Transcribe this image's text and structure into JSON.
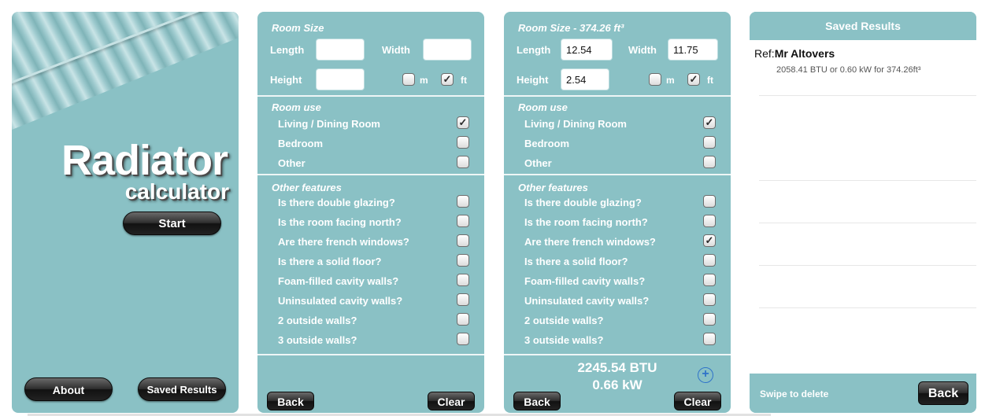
{
  "home": {
    "title": "Radiator",
    "subtitle": "calculator",
    "start_label": "Start",
    "about_label": "About",
    "saved_label": "Saved Results"
  },
  "calc_empty": {
    "room_size_title": "Room Size",
    "length_label": "Length",
    "width_label": "Width",
    "height_label": "Height",
    "length_value": "",
    "width_value": "",
    "height_value": "",
    "unit_m": "m",
    "unit_ft": "ft",
    "m_checked": "",
    "ft_checked": "✓",
    "room_use_title": "Room use",
    "room_use": [
      {
        "label": "Living / Dining Room",
        "checked": "✓"
      },
      {
        "label": "Bedroom",
        "checked": ""
      },
      {
        "label": "Other",
        "checked": ""
      }
    ],
    "features_title": "Other features",
    "features": [
      {
        "label": "Is there double glazing?",
        "checked": ""
      },
      {
        "label": "Is the room facing north?",
        "checked": ""
      },
      {
        "label": "Are there french windows?",
        "checked": ""
      },
      {
        "label": "Is there a solid floor?",
        "checked": ""
      },
      {
        "label": "Foam-filled cavity walls?",
        "checked": ""
      },
      {
        "label": "Uninsulated cavity walls?",
        "checked": ""
      },
      {
        "label": "2 outside walls?",
        "checked": ""
      },
      {
        "label": "3 outside walls?",
        "checked": ""
      }
    ],
    "back_label": "Back",
    "clear_label": "Clear"
  },
  "calc_filled": {
    "room_size_title": "Room Size - 374.26 ft³",
    "length_label": "Length",
    "width_label": "Width",
    "height_label": "Height",
    "length_value": "12.54",
    "width_value": "11.75",
    "height_value": "2.54",
    "unit_m": "m",
    "unit_ft": "ft",
    "m_checked": "",
    "ft_checked": "✓",
    "room_use_title": "Room use",
    "room_use": [
      {
        "label": "Living / Dining Room",
        "checked": "✓"
      },
      {
        "label": "Bedroom",
        "checked": ""
      },
      {
        "label": "Other",
        "checked": ""
      }
    ],
    "features_title": "Other features",
    "features": [
      {
        "label": "Is there double glazing?",
        "checked": ""
      },
      {
        "label": "Is the room facing north?",
        "checked": ""
      },
      {
        "label": "Are there french windows?",
        "checked": "✓"
      },
      {
        "label": "Is there a solid floor?",
        "checked": ""
      },
      {
        "label": "Foam-filled cavity walls?",
        "checked": ""
      },
      {
        "label": "Uninsulated cavity walls?",
        "checked": ""
      },
      {
        "label": "2 outside walls?",
        "checked": ""
      },
      {
        "label": "3 outside walls?",
        "checked": ""
      }
    ],
    "result_btu": "2245.54 BTU",
    "result_kw": "0.66 kW",
    "add_symbol": "+",
    "back_label": "Back",
    "clear_label": "Clear"
  },
  "saved": {
    "header": "Saved Results",
    "entries": [
      {
        "ref_prefix": "Ref:",
        "ref_name": "Mr Altovers",
        "detail": "2058.41 BTU or 0.60 kW for 374.26ft³"
      }
    ],
    "swipe_hint": "Swipe to delete",
    "back_label": "Back"
  },
  "colors": {
    "panel": "#8ac1c5",
    "stripe_light": "#c9e4e6",
    "button_dark": "#1a1a1a",
    "add_icon": "#2f73c9"
  }
}
